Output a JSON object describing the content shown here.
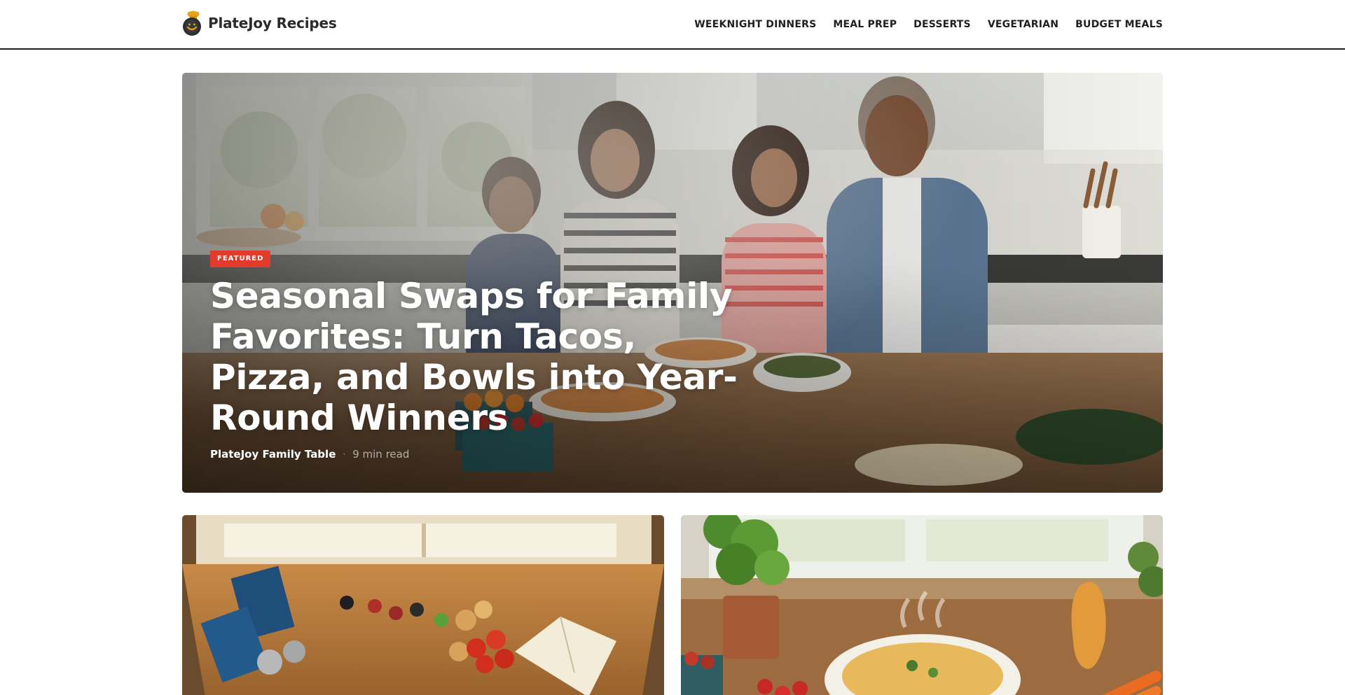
{
  "header": {
    "logo_text": "PlateJoy Recipes",
    "nav": [
      {
        "label": "WEEKNIGHT DINNERS"
      },
      {
        "label": "MEAL PREP"
      },
      {
        "label": "DESSERTS"
      },
      {
        "label": "VEGETARIAN"
      },
      {
        "label": "BUDGET MEALS"
      }
    ]
  },
  "hero": {
    "badge": "FEATURED",
    "title": "Seasonal Swaps for Family Favorites: Turn Tacos, Pizza, and Bowls into Year-Round Winners",
    "author": "PlateJoy Family Table",
    "separator": "·",
    "read_time": "9 min read"
  },
  "colors": {
    "accent": "#e33b2b",
    "logo_yellow": "#e8a617",
    "text": "#1f1f1f"
  },
  "icons": {
    "logo": "chef-hat-pot-icon"
  }
}
